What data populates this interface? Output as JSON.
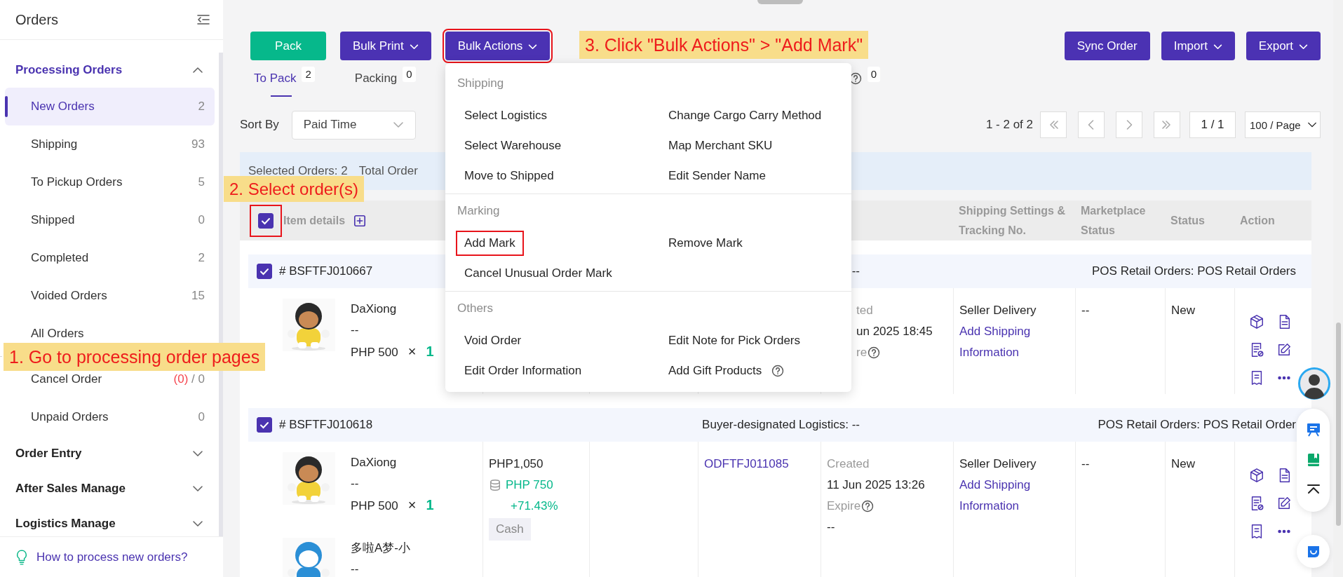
{
  "sidebar": {
    "title": "Orders",
    "groups": [
      {
        "label": "Processing Orders",
        "expanded": true,
        "items": [
          {
            "kind": "entry",
            "label": "New Orders",
            "count": "2",
            "selected": true
          },
          {
            "kind": "entry",
            "label": "Shipping",
            "count": "93",
            "selected": false
          },
          {
            "kind": "entry",
            "label": "To Pickup Orders",
            "count": "5",
            "selected": false
          },
          {
            "kind": "entry",
            "label": "Shipped",
            "count": "0",
            "selected": false
          },
          {
            "kind": "entry",
            "label": "Completed",
            "count": "2",
            "selected": false
          },
          {
            "kind": "entry",
            "label": "Voided Orders",
            "count": "15",
            "selected": false
          },
          {
            "kind": "entry",
            "label": "All Orders",
            "selected": false
          },
          {
            "kind": "divider"
          },
          {
            "kind": "entry",
            "label": "Cancel Order",
            "alert_count": "(0)",
            "count": "/ 0",
            "selected": false
          },
          {
            "kind": "entry",
            "label": "Unpaid Orders",
            "count": "0",
            "selected": false
          }
        ]
      },
      {
        "label": "Order Entry",
        "expanded": false
      },
      {
        "label": "After Sales Manage",
        "expanded": false
      },
      {
        "label": "Logistics Manage",
        "expanded": false
      }
    ],
    "help_link": "How to process new orders?"
  },
  "toolbar": {
    "left_buttons": [
      {
        "label": "Pack",
        "kind": "success",
        "dropdown": false,
        "highlighted": false
      },
      {
        "label": "Bulk Print",
        "kind": "primary",
        "dropdown": true,
        "highlighted": false
      },
      {
        "label": "Bulk Actions",
        "kind": "primary",
        "dropdown": true,
        "highlighted": true
      }
    ],
    "right_buttons": [
      {
        "label": "Sync Order",
        "kind": "primary",
        "dropdown": false,
        "highlighted": false
      },
      {
        "label": "Import",
        "kind": "primary",
        "dropdown": true,
        "highlighted": false
      },
      {
        "label": "Export",
        "kind": "primary",
        "dropdown": true,
        "highlighted": false
      }
    ]
  },
  "tabs": [
    {
      "label": "To Pack",
      "count": "2",
      "selected": true
    },
    {
      "label": "Packing",
      "count": "0",
      "selected": false
    }
  ],
  "tab_fragment": {
    "count": "0"
  },
  "sort": {
    "label": "Sort By",
    "value": "Paid Time"
  },
  "pagination": {
    "range": "1 - 2 of 2",
    "page": "1 / 1",
    "page_size": "100 / Page"
  },
  "selection_bar": {
    "selected": "Selected Orders: 2",
    "total": "Total Order"
  },
  "table": {
    "columns": [
      {
        "label": "Item details",
        "checked": true,
        "highlighted": true
      },
      {
        "label": "Shipping Settings & Tracking No."
      },
      {
        "label": "Marketplace Status"
      },
      {
        "label": "Status"
      },
      {
        "label": "Action"
      }
    ],
    "orders": [
      {
        "number": "# BSFTFJ010667",
        "checked": true,
        "covered": true,
        "logistics": "--",
        "source": "POS Retail Orders: POS Retail Orders",
        "products": [
          {
            "name": "DaXiong",
            "sku": "--",
            "price": "PHP 500",
            "times": "×",
            "quantity": "1"
          }
        ],
        "created": {
          "label": "ted",
          "time": "un 2025 18:45",
          "expire": "re"
        },
        "shipping": {
          "method": "Seller Delivery",
          "link": "Add Shipping Information"
        },
        "marketplace_status": "--",
        "status": "New"
      },
      {
        "number": "# BSFTFJ010618",
        "checked": true,
        "covered": false,
        "logistics": "Buyer-designated Logistics: --",
        "source": "POS Retail Orders: POS Retail Order",
        "products": [
          {
            "name": "DaXiong",
            "sku": "--",
            "price": "PHP 500",
            "times": "×",
            "quantity": "1"
          },
          {
            "name": "多啦A梦-小",
            "sku": "--"
          }
        ],
        "payment": {
          "total": "PHP1,050",
          "cost": "PHP 750",
          "margin": "+71.43%",
          "method": "Cash"
        },
        "reference": "ODFTFJ011085",
        "created": {
          "label": "Created",
          "time": "11 Jun 2025 13:26",
          "expire": "Expire",
          "deadline": "--"
        },
        "shipping": {
          "method": "Seller Delivery",
          "link": "Add Shipping Information"
        },
        "marketplace_status": "--",
        "status": "New"
      }
    ]
  },
  "bulk_actions_menu": {
    "sections": [
      {
        "title": "Shipping",
        "items": [
          {
            "label": "Select Logistics",
            "highlighted": false,
            "help": false
          },
          {
            "label": "Change Cargo Carry Method",
            "highlighted": false,
            "help": false
          },
          {
            "label": "Select Warehouse",
            "highlighted": false,
            "help": false
          },
          {
            "label": "Map Merchant SKU",
            "highlighted": false,
            "help": false
          },
          {
            "label": "Move to Shipped",
            "highlighted": false,
            "help": false
          },
          {
            "label": "Edit Sender Name",
            "highlighted": false,
            "help": false
          }
        ]
      },
      {
        "title": "Marking",
        "items": [
          {
            "label": "Add Mark",
            "highlighted": true,
            "help": false
          },
          {
            "label": "Remove Mark",
            "highlighted": false,
            "help": false
          },
          {
            "label": "Cancel Unusual Order Mark",
            "highlighted": false,
            "help": false
          }
        ]
      },
      {
        "title": "Others",
        "items": [
          {
            "label": "Void Order",
            "highlighted": false,
            "help": false
          },
          {
            "label": "Edit Note for Pick Orders",
            "highlighted": false,
            "help": false
          },
          {
            "label": "Edit Order Information",
            "highlighted": false,
            "help": false
          },
          {
            "label": "Add Gift Products",
            "highlighted": false,
            "help": true
          }
        ]
      }
    ]
  },
  "annotations": [
    {
      "text": "1. Go to processing order pages"
    },
    {
      "text": "2. Select order(s)"
    },
    {
      "text": "3. Click \"Bulk Actions\" > \"Add Mark\""
    }
  ]
}
